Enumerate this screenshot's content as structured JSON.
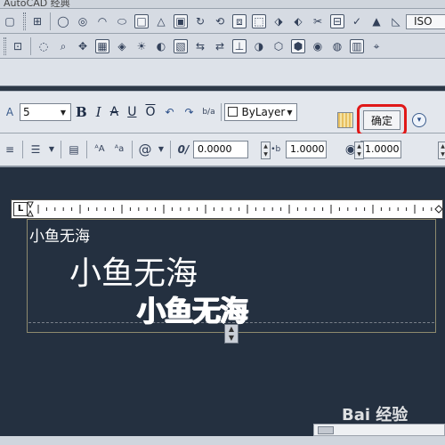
{
  "app": {
    "title": "AutoCAD 经典"
  },
  "toolbar": {
    "iso_label": "ISO"
  },
  "format_bar": {
    "text_height": "5",
    "bold_label": "B",
    "italic_label": "I",
    "strike_label": "A",
    "underline_label": "U",
    "overline_label": "O",
    "stack_label": "b/a",
    "color_label": "ByLayer",
    "ok_label": "确定",
    "highlight_color": "#e01818"
  },
  "paragraph_bar": {
    "oblique_value": "0.0000",
    "tracking_label": "a•b",
    "tracking_value": "1.0000",
    "width_value": "1.0000"
  },
  "editor": {
    "ruler_tab_label": "L",
    "lines": [
      "小鱼无海",
      "小鱼无海",
      "小鱼无海"
    ]
  },
  "watermark": {
    "text": "Bai 经验"
  }
}
